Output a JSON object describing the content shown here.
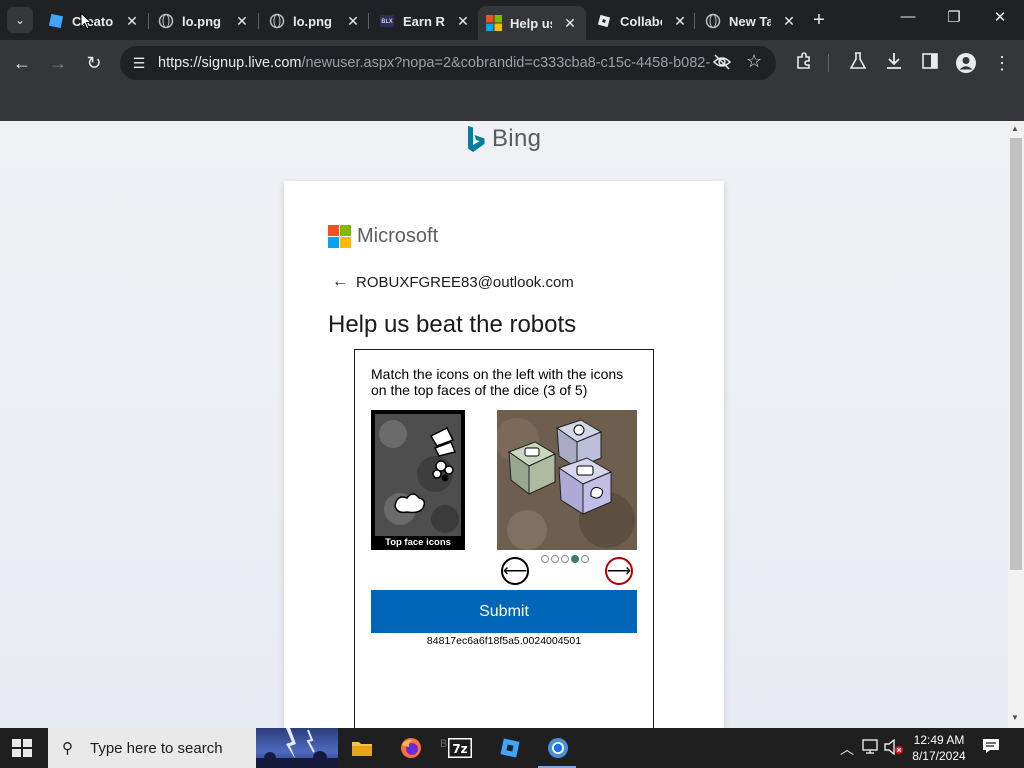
{
  "browser": {
    "tabs": [
      {
        "title": "Creator",
        "favicon": "roblox-studio-icon",
        "active": false
      },
      {
        "title": "lo.png",
        "favicon": "globe-icon",
        "active": false
      },
      {
        "title": "lo.png",
        "favicon": "globe-icon",
        "active": false
      },
      {
        "title": "Earn Robux",
        "favicon": "earn-site-icon",
        "active": false
      },
      {
        "title": "Help us beat the robots",
        "favicon": "microsoft-icon",
        "active": true
      },
      {
        "title": "Collaborate",
        "favicon": "roblox-icon",
        "active": false
      },
      {
        "title": "New Tab",
        "favicon": "globe-icon",
        "active": false
      }
    ],
    "url_host": "https://signup.live.com",
    "url_path": "/newuser.aspx?nopa=2&cobrandid=c333cba8-c15c-4458-b082-..."
  },
  "page": {
    "bing_label": "Bing",
    "ms_label": "Microsoft",
    "account_email": "ROBUXFGREE83@outlook.com",
    "heading": "Help us beat the robots",
    "challenge": {
      "instructions": "Match the icons on the left with the icons on the top faces of the dice (3 of 5)",
      "icons_caption": "Top face icons",
      "dots_total": 5,
      "dots_active": 4,
      "submit_label": "Submit",
      "session_id": "84817ec6a6f18f5a5.0024004501"
    }
  },
  "taskbar": {
    "search_placeholder": "Type here to search",
    "time": "12:49 AM",
    "date": "8/17/2024"
  },
  "colors": {
    "ms_red": "#f25022",
    "ms_green": "#7fba00",
    "ms_blue": "#00a4ef",
    "ms_yellow": "#ffb900",
    "submit_blue": "#0067b8",
    "bing_teal": "#00809d"
  }
}
